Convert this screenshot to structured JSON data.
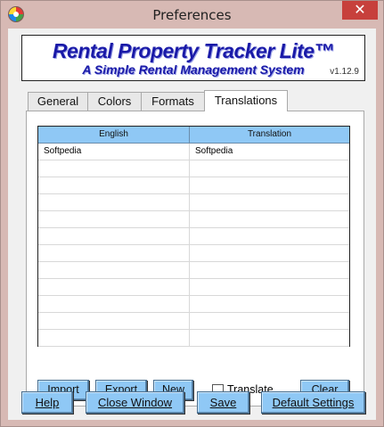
{
  "window": {
    "title": "Preferences",
    "close_glyph": "✕"
  },
  "banner": {
    "title": "Rental Property Tracker Lite™",
    "subtitle": "A Simple Rental Management System",
    "version": "v1.12.9"
  },
  "tabs": [
    {
      "label": "General",
      "active": false
    },
    {
      "label": "Colors",
      "active": false
    },
    {
      "label": "Formats",
      "active": false
    },
    {
      "label": "Translations",
      "active": true
    }
  ],
  "grid": {
    "columns": [
      "English",
      "Translation"
    ],
    "rows": [
      [
        "Softpedia",
        "Softpedia"
      ],
      [
        "",
        ""
      ],
      [
        "",
        ""
      ],
      [
        "",
        ""
      ],
      [
        "",
        ""
      ],
      [
        "",
        ""
      ],
      [
        "",
        ""
      ],
      [
        "",
        ""
      ],
      [
        "",
        ""
      ],
      [
        "",
        ""
      ],
      [
        "",
        ""
      ],
      [
        "",
        ""
      ]
    ]
  },
  "panel_buttons": {
    "import": "Import",
    "export": "Export",
    "new": "New",
    "translate_label": "Translate",
    "translate_checked": false,
    "clear": "Clear"
  },
  "footer_buttons": {
    "help": "Help",
    "close_window": "Close Window",
    "save": "Save",
    "default_settings": "Default Settings"
  },
  "colors": {
    "accent": "#8fc8f5",
    "titlebar": "#d7b9b4",
    "close": "#c7403c",
    "banner_text": "#1a1aa8"
  }
}
